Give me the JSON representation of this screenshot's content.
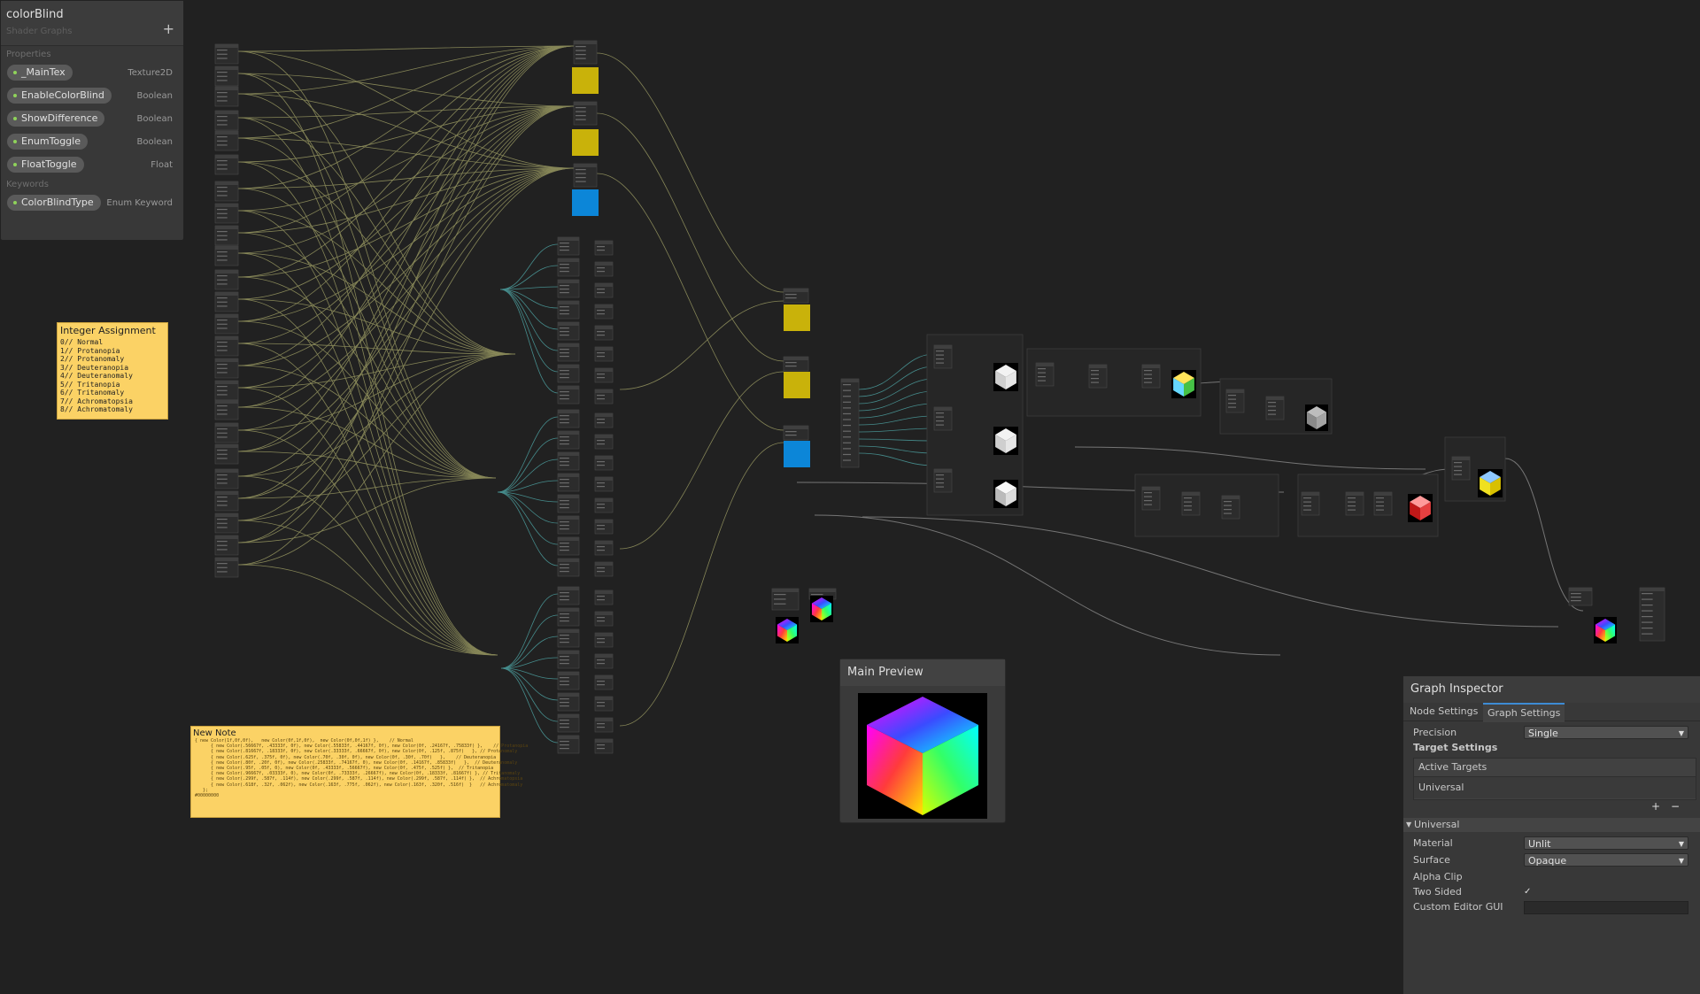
{
  "blackboard": {
    "title": "colorBlind",
    "subtitle": "Shader Graphs",
    "add_icon": "+",
    "properties_label": "Properties",
    "properties": [
      {
        "name": "_MainTex",
        "type": "Texture2D"
      },
      {
        "name": "EnableColorBlind",
        "type": "Boolean"
      },
      {
        "name": "ShowDifference",
        "type": "Boolean"
      },
      {
        "name": "EnumToggle",
        "type": "Boolean"
      },
      {
        "name": "FloatToggle",
        "type": "Float"
      }
    ],
    "keywords_label": "Keywords",
    "keywords": [
      {
        "name": "ColorBlindType",
        "type": "Enum Keyword"
      }
    ]
  },
  "sticky_integer": {
    "title": "Integer Assignment",
    "lines": [
      "0// Normal",
      "1// Protanopia",
      "2// Protanomaly",
      "3// Deuteranopia",
      "4// Deuteranomaly",
      "5// Tritanopia",
      "6// Tritanomaly",
      "7// Achromatopsia",
      "8// Achromatomaly"
    ]
  },
  "sticky_note": {
    "title": "New Note",
    "lines": [
      "{ new Color(1f,0f,0f),   new Color(0f,1f,0f),  new Color(0f,0f,1f) },    // Normal",
      "      { new Color(.56667f, .43333f, 0f), new Color(.55833f, .44167f, 0f), new Color(0f, .24167f, .75833f) },    // Protanopia",
      "      { new Color(.81667f, .18333f, 0f), new Color(.33333f, .66667f, 0f), new Color(0f, .125f, .875f)   }, // Protanomaly",
      "      { new Color(.625f, .375f, 0f), new Color(.70f, .30f, 0f), new Color(0f, .30f, .70f)   },    // Deuteranopia",
      "      { new Color(.80f, .20f, 0f), new Color(.25833f, .74167f, 0), new Color(0f, .14167f, .85833f)   },  // Deuteranomaly",
      "      { new Color(.95f, .05f, 0), new Color(0f, .43333f, .56667f), new Color(0f, .475f, .525f) },  // Tritanopia",
      "      { new Color(.96667f, .03333f, 0), new Color(0f, .73333f, .26667f), new Color(0f, .18333f, .81667f) }, // Tritanomaly",
      "      { new Color(.299f, .587f, .114f), new Color(.299f, .587f, .114f), new Color(.299f, .587f, .114f) },  // Achromatopsia",
      "      { new Color(.618f, .32f, .062f), new Color(.163f, .775f, .062f), new Color(.163f, .320f, .516f)  }   // Achromatomaly",
      "   };",
      "",
      "#00000000"
    ]
  },
  "main_preview": {
    "title": "Main Preview"
  },
  "inspector": {
    "title": "Graph Inspector",
    "tabs": [
      "Node Settings",
      "Graph Settings"
    ],
    "active_tab": "Graph Settings",
    "precision_label": "Precision",
    "precision_value": "Single",
    "target_settings_label": "Target Settings",
    "active_targets_label": "Active Targets",
    "active_targets": [
      "Universal"
    ],
    "add_label": "+",
    "remove_label": "−",
    "universal_header": "Universal",
    "material_label": "Material",
    "material_value": "Unlit",
    "surface_label": "Surface",
    "surface_value": "Opaque",
    "alpha_clip_label": "Alpha Clip",
    "alpha_clip": false,
    "two_sided_label": "Two Sided",
    "two_sided": true,
    "two_sided_mark": "✓",
    "custom_editor_label": "Custom Editor GUI",
    "custom_editor_value": ""
  },
  "colors": {
    "background": "#212121",
    "sticky": "#fbd265",
    "swatch_yellow": "#c9b20a",
    "swatch_blue": "#0c86d8",
    "edge_olive": "#a8a86a",
    "edge_teal": "#4fa7a7"
  }
}
